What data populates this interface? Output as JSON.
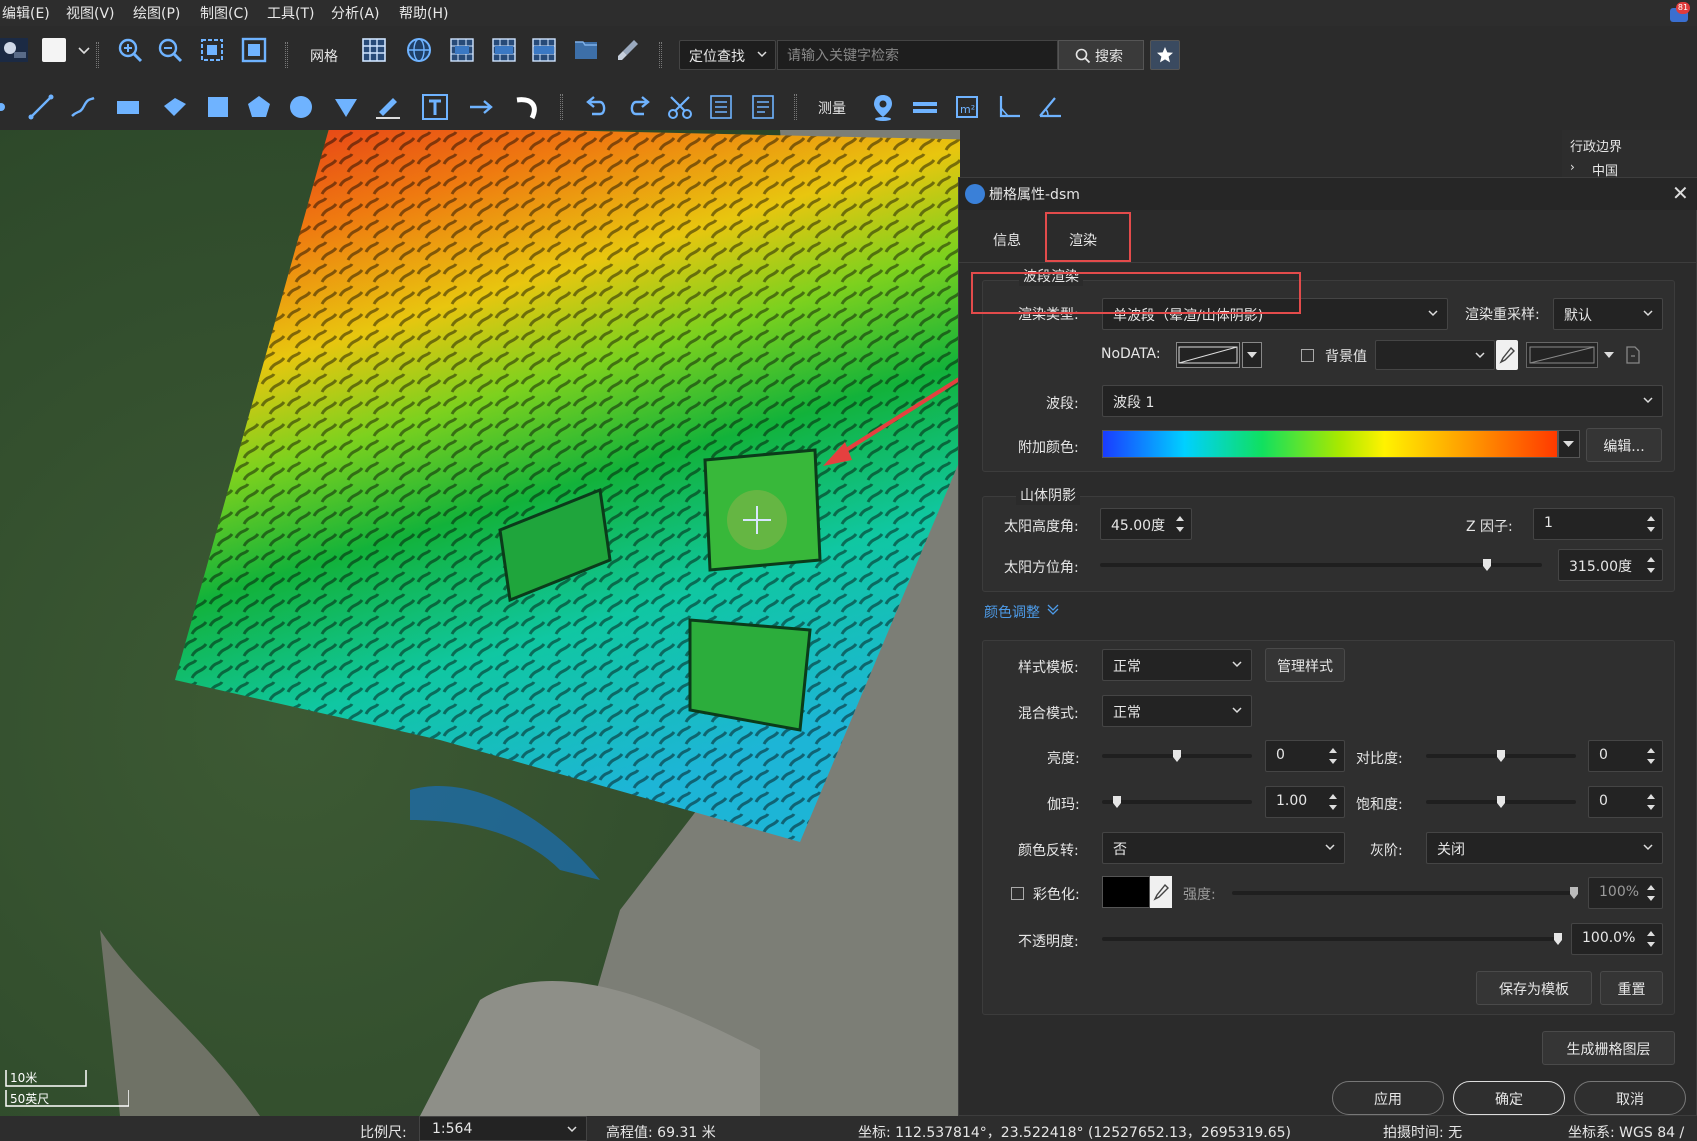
{
  "menu": [
    "编辑(E)",
    "视图(V)",
    "绘图(P)",
    "制图(C)",
    "工具(T)",
    "分析(A)",
    "帮助(H)"
  ],
  "notification_count": "81",
  "toolbar1": {
    "grid_label": "网格",
    "locate_mode": "定位查找",
    "search_placeholder": "请输入关键字检索",
    "search_button": "搜索"
  },
  "toolbar2": {
    "measure_label": "测量"
  },
  "layer_panel": {
    "title": "行政边界",
    "node": "中国"
  },
  "map": {
    "scale_meters": "10米",
    "scale_feet": "50英尺"
  },
  "dialog": {
    "title": "栅格属性-dsm",
    "tabs": [
      "信息",
      "渲染"
    ],
    "active_tab": "渲染",
    "band_render": {
      "group_title": "波段渲染",
      "render_type_label": "渲染类型:",
      "render_type_value": "单波段（晕渲/山体阴影)",
      "resample_label": "渲染重采样:",
      "resample_value": "默认",
      "nodata_label": "NoDATA:",
      "background_label": "背景值",
      "band_label": "波段:",
      "band_value": "波段 1",
      "color_label": "附加颜色:",
      "edit_button": "编辑..."
    },
    "hillshade": {
      "group_title": "山体阴影",
      "altitude_label": "太阳高度角:",
      "altitude_value": "45.00度",
      "z_factor_label": "Z 因子:",
      "z_factor_value": "1",
      "azimuth_label": "太阳方位角:",
      "azimuth_value": "315.00度",
      "azimuth_slider_fraction": 0.875
    },
    "color_adjust": {
      "toggle_label": "颜色调整",
      "style_template_label": "样式模板:",
      "style_template_value": "正常",
      "manage_styles_button": "管理样式",
      "blend_mode_label": "混合模式:",
      "blend_mode_value": "正常",
      "brightness_label": "亮度:",
      "brightness_value": "0",
      "brightness_slider_fraction": 0.5,
      "contrast_label": "对比度:",
      "contrast_value": "0",
      "contrast_slider_fraction": 0.5,
      "gamma_label": "伽玛:",
      "gamma_value": "1.00",
      "gamma_slider_fraction": 0.1,
      "saturation_label": "饱和度:",
      "saturation_value": "0",
      "saturation_slider_fraction": 0.5,
      "invert_label": "颜色反转:",
      "invert_value": "否",
      "grayscale_label": "灰阶:",
      "grayscale_value": "关闭",
      "colorize_label": "彩色化:",
      "intensity_label": "强度:",
      "intensity_value": "100%",
      "opacity_label": "不透明度:",
      "opacity_value": "100.0%",
      "save_template_button": "保存为模板",
      "reset_button": "重置"
    },
    "generate_button": "生成栅格图层",
    "apply_button": "应用",
    "ok_button": "确定",
    "cancel_button": "取消"
  },
  "status": {
    "scale_label": "比例尺:",
    "scale_value": "1:564",
    "elevation": "高程值: 69.31 米",
    "coords": "坐标: 112.537814°，23.522418°   (12527652.13，2695319.65)",
    "capture_time": "拍摄时间: 无",
    "crs": "坐标系: WGS 84 /"
  },
  "colors": {
    "accent_red": "#e34b4b",
    "dialog_bg": "#2b2b2b",
    "highlight_blue": "#3a80d8"
  }
}
